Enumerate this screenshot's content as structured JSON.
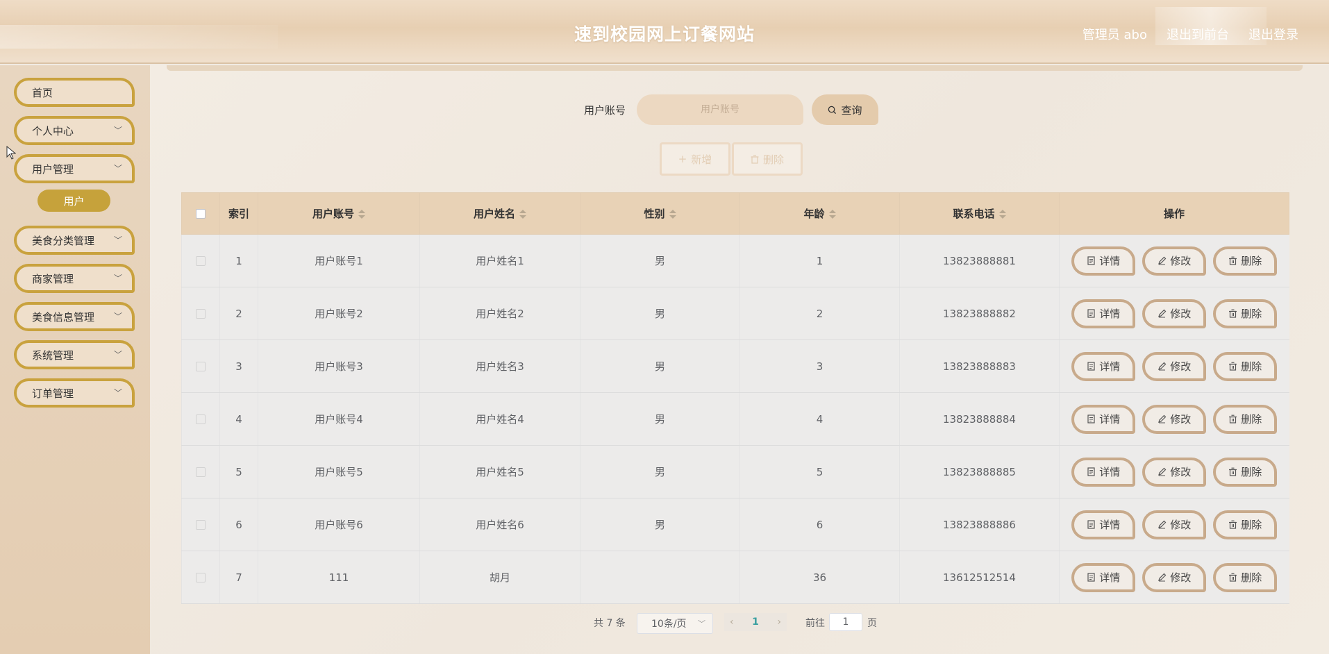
{
  "header": {
    "title": "速到校园网上订餐网站",
    "admin": "管理员 abo",
    "back_to_front": "退出到前台",
    "logout": "退出登录"
  },
  "sidebar": {
    "items": [
      {
        "label": "首页",
        "has_children": false
      },
      {
        "label": "个人中心",
        "has_children": true
      },
      {
        "label": "用户管理",
        "has_children": true
      },
      {
        "label": "美食分类管理",
        "has_children": true
      },
      {
        "label": "商家管理",
        "has_children": true
      },
      {
        "label": "美食信息管理",
        "has_children": true
      },
      {
        "label": "系统管理",
        "has_children": true
      },
      {
        "label": "订单管理",
        "has_children": true
      }
    ],
    "active_submenu": "用户"
  },
  "search": {
    "label": "用户账号",
    "placeholder": "用户账号",
    "button": "查询"
  },
  "actions": {
    "add": "新增",
    "delete": "删除"
  },
  "table": {
    "headers": [
      "索引",
      "用户账号",
      "用户姓名",
      "性别",
      "年龄",
      "联系电话",
      "操作"
    ],
    "rows": [
      {
        "index": "1",
        "account": "用户账号1",
        "name": "用户姓名1",
        "gender": "男",
        "age": "1",
        "phone": "13823888881"
      },
      {
        "index": "2",
        "account": "用户账号2",
        "name": "用户姓名2",
        "gender": "男",
        "age": "2",
        "phone": "13823888882"
      },
      {
        "index": "3",
        "account": "用户账号3",
        "name": "用户姓名3",
        "gender": "男",
        "age": "3",
        "phone": "13823888883"
      },
      {
        "index": "4",
        "account": "用户账号4",
        "name": "用户姓名4",
        "gender": "男",
        "age": "4",
        "phone": "13823888884"
      },
      {
        "index": "5",
        "account": "用户账号5",
        "name": "用户姓名5",
        "gender": "男",
        "age": "5",
        "phone": "13823888885"
      },
      {
        "index": "6",
        "account": "用户账号6",
        "name": "用户姓名6",
        "gender": "男",
        "age": "6",
        "phone": "13823888886"
      },
      {
        "index": "7",
        "account": "111",
        "name": "胡月",
        "gender": "",
        "age": "36",
        "phone": "13612512514"
      }
    ],
    "row_actions": {
      "detail": "详情",
      "edit": "修改",
      "delete": "删除"
    }
  },
  "pagination": {
    "total": "共 7 条",
    "page_size": "10条/页",
    "current_page": "1",
    "goto_label": "前往",
    "goto_value": "1",
    "page_suffix": "页"
  },
  "colors": {
    "accent_gold": "#c9a23e",
    "header_bg": "#e7cfb2",
    "table_header": "#e8d2b6"
  }
}
